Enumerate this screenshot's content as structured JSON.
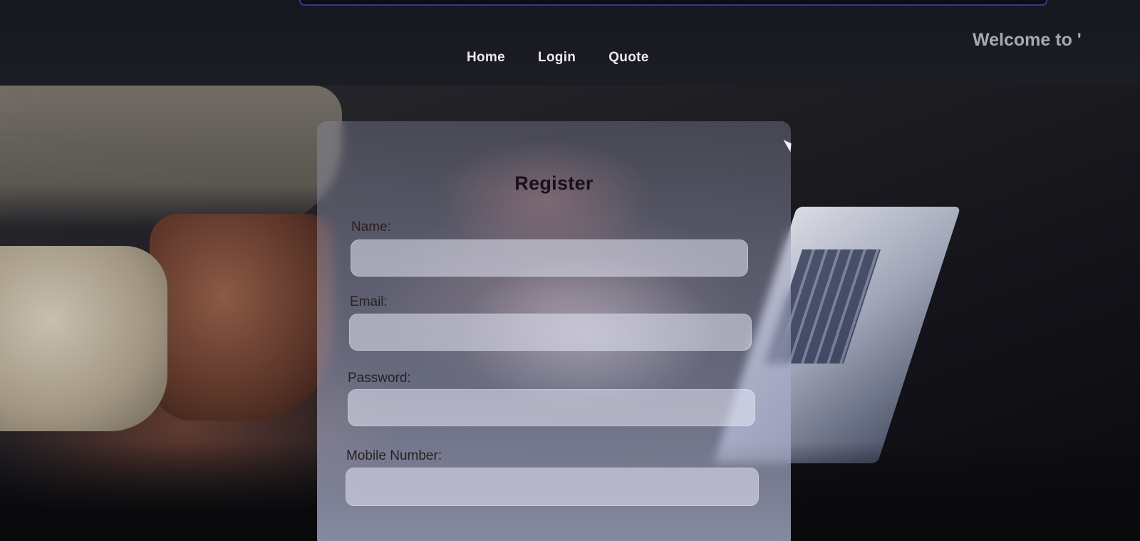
{
  "header": {
    "nav": [
      {
        "label": "Home"
      },
      {
        "label": "Login"
      },
      {
        "label": "Quote"
      }
    ],
    "welcome_text": "Welcome to '"
  },
  "register_form": {
    "title": "Register",
    "fields": [
      {
        "label": "Name:",
        "value": "",
        "placeholder": ""
      },
      {
        "label": "Email:",
        "value": "",
        "placeholder": ""
      },
      {
        "label": "Password:",
        "value": "",
        "placeholder": ""
      },
      {
        "label": "Mobile Number:",
        "value": "",
        "placeholder": ""
      }
    ]
  }
}
